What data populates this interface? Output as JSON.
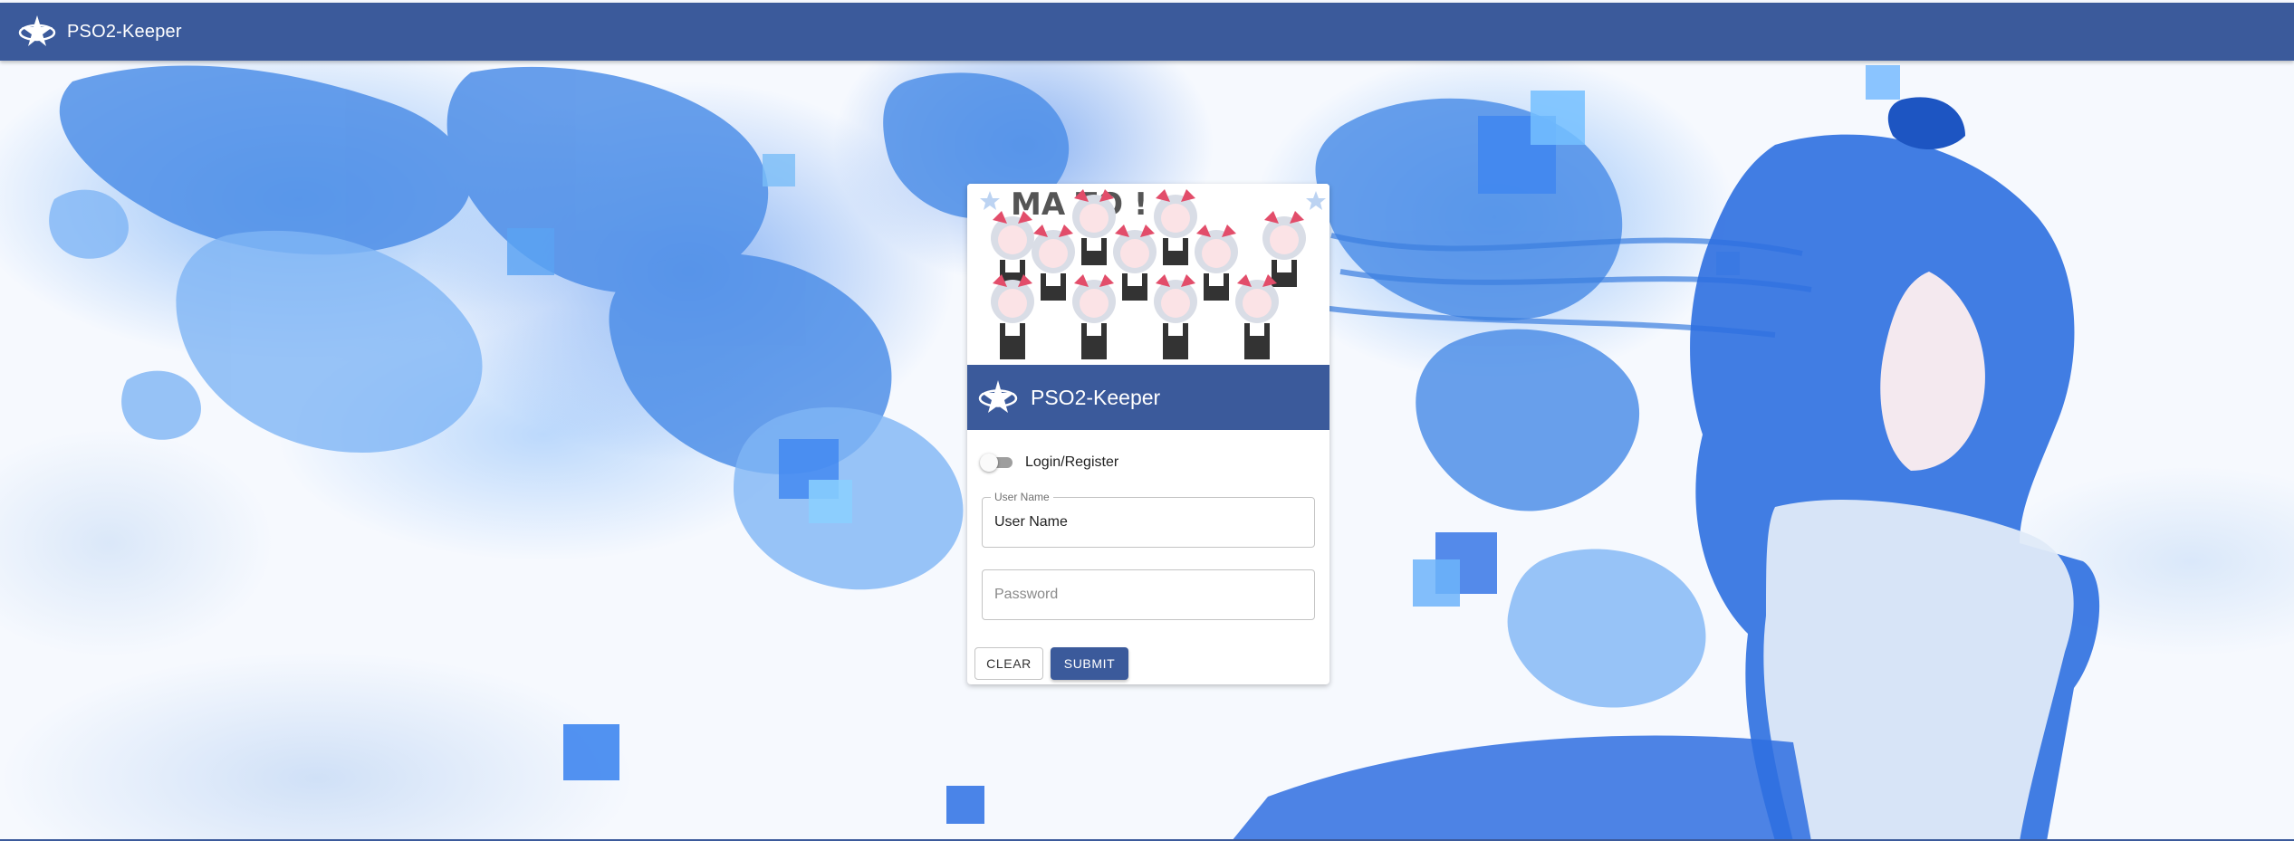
{
  "appbar": {
    "title": "PSO2-Keeper"
  },
  "card": {
    "media_text": "MA  TO !",
    "header_title": "PSO2-Keeper",
    "mode_toggle_label": "Login/Register",
    "username": {
      "label": "User Name",
      "value": "User Name"
    },
    "password": {
      "placeholder": "Password",
      "value": ""
    },
    "clear_label": "CLEAR",
    "submit_label": "SUBMIT"
  },
  "colors": {
    "primary": "#3b5a9b",
    "background_art": "#5f9ff0"
  },
  "icons": {
    "logo": "star-logo-icon",
    "toggle": "switch"
  }
}
